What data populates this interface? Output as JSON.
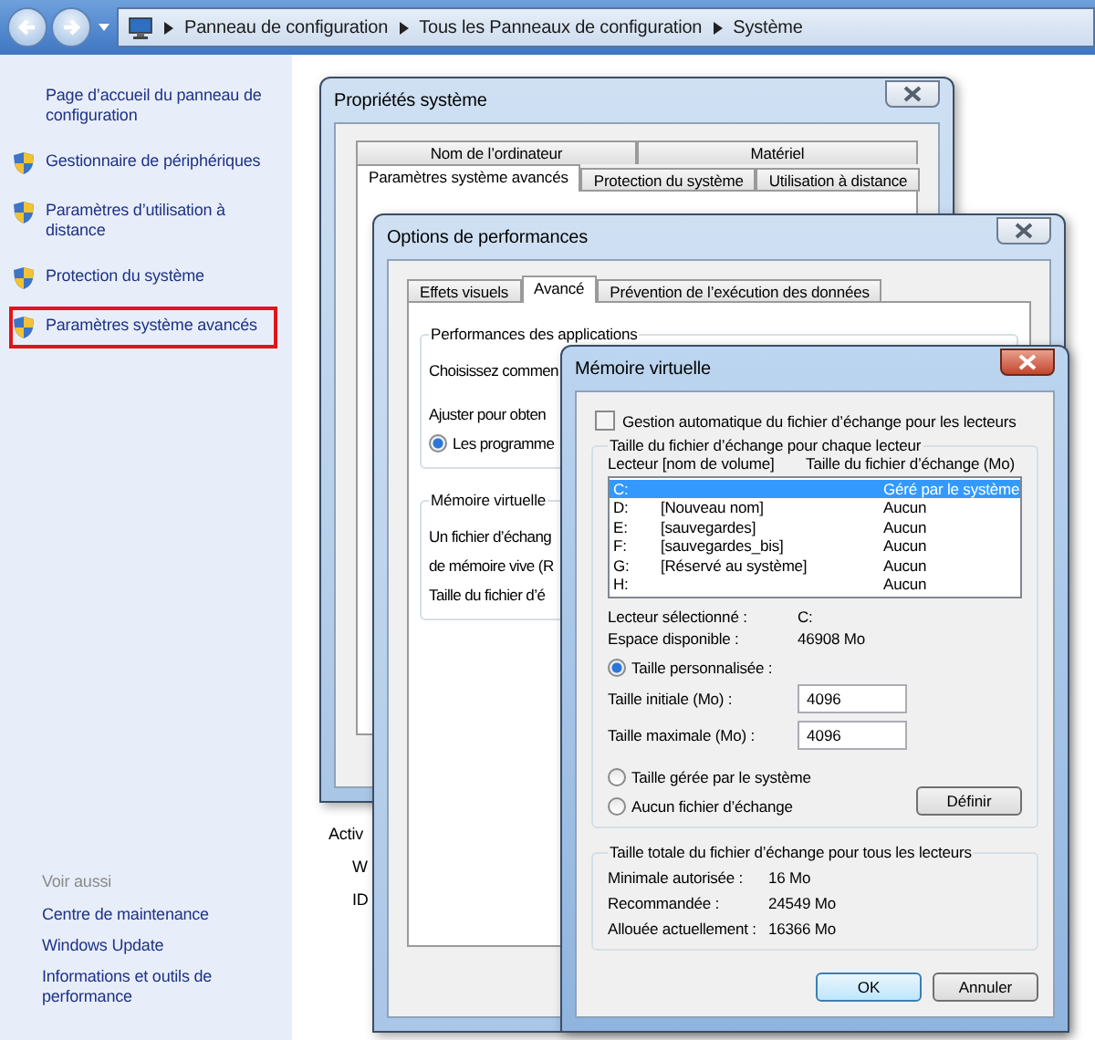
{
  "address_bar": {
    "breadcrumb": [
      "Panneau de configuration",
      "Tous les Panneaux de configuration",
      "Système"
    ]
  },
  "sidebar": {
    "items": [
      {
        "kind": "plain",
        "label": "Page d’accueil du panneau de configuration",
        "highlighted": false
      },
      {
        "kind": "shield",
        "label": "Gestionnaire de périphériques",
        "highlighted": false
      },
      {
        "kind": "shield",
        "label": "Paramètres d’utilisation à distance",
        "highlighted": false
      },
      {
        "kind": "shield",
        "label": "Protection du système",
        "highlighted": false
      },
      {
        "kind": "shield",
        "label": "Paramètres système avancés",
        "highlighted": true
      }
    ],
    "see_also": {
      "title": "Voir aussi",
      "items": [
        "Centre de maintenance",
        "Windows Update",
        "Informations et outils de performance"
      ]
    }
  },
  "page": {
    "heading": "Activ",
    "lines": [
      "W",
      "ID"
    ]
  },
  "system_properties": {
    "title": "Propriétés système",
    "active": false,
    "tab_rows": [
      {
        "tabs": [
          {
            "label": "Nom de l’ordinateur",
            "selected": false
          },
          {
            "label": "Matériel",
            "selected": false
          }
        ]
      },
      {
        "tabs": [
          {
            "label": "Paramètres système avancés",
            "selected": true
          },
          {
            "label": "Protection du système",
            "selected": false
          },
          {
            "label": "Utilisation à distance",
            "selected": false
          }
        ]
      }
    ]
  },
  "performance_options": {
    "title": "Options de performances",
    "active": false,
    "tabs": [
      {
        "label": "Effets visuels",
        "selected": false
      },
      {
        "label": "Avancé",
        "selected": true
      },
      {
        "label": "Prévention de l’exécution des données",
        "selected": false
      }
    ],
    "groups": [
      {
        "title": "Performances des applications",
        "lines": [
          {
            "kind": "text",
            "text": "Choisissez commen"
          },
          {
            "kind": "text",
            "text": "Ajuster pour obten"
          },
          {
            "kind": "radio",
            "text": "Les programme",
            "selected": true
          }
        ]
      },
      {
        "title": "Mémoire virtuelle",
        "lines": [
          {
            "kind": "text",
            "text": "Un fichier d’échang"
          },
          {
            "kind": "text",
            "text": "de mémoire vive (R"
          },
          {
            "kind": "text",
            "text": "Taille du fichier d’é"
          }
        ]
      }
    ]
  },
  "virtual_memory": {
    "title": "Mémoire virtuelle",
    "active": true,
    "automatic": {
      "label": "Gestion automatique du fichier d’échange pour les lecteurs",
      "checked": false
    },
    "drives_group": {
      "title": "Taille du fichier d’échange pour chaque lecteur",
      "columns": [
        "Lecteur [nom de volume]",
        "Taille du fichier d’échange (Mo)"
      ],
      "rows": [
        {
          "drive": "C:",
          "size": "Géré par le système",
          "selected": true
        },
        {
          "drive": "D:",
          "volume": "[Nouveau nom]",
          "size": "Aucun",
          "selected": false
        },
        {
          "drive": "E:",
          "volume": "[sauvegardes]",
          "size": "Aucun",
          "selected": false
        },
        {
          "drive": "F:",
          "volume": "[sauvegardes_bis]",
          "size": "Aucun",
          "selected": false
        },
        {
          "drive": "G:",
          "volume": "[Réservé au système]",
          "size": "Aucun",
          "selected": false
        },
        {
          "drive": "H:",
          "size": "Aucun",
          "selected": false
        }
      ],
      "info": [
        {
          "label": "Lecteur sélectionné :",
          "value": "C:"
        },
        {
          "label": "Espace disponible :",
          "value": "46908 Mo"
        }
      ],
      "size_options": [
        {
          "label": "Taille personnalisée :",
          "selected": true
        },
        {
          "label": "Taille gérée par le système",
          "selected": false
        },
        {
          "label": "Aucun fichier d’échange",
          "selected": false
        }
      ],
      "fields": [
        {
          "label": "Taille initiale (Mo) :",
          "value": "4096"
        },
        {
          "label": "Taille maximale (Mo) :",
          "value": "4096"
        }
      ],
      "set_button": "Définir"
    },
    "totals_group": {
      "title": "Taille totale du fichier d’échange pour tous les lecteurs",
      "rows": [
        {
          "label": "Minimale autorisée :",
          "value": "16 Mo"
        },
        {
          "label": "Recommandée :",
          "value": "24549 Mo"
        },
        {
          "label": "Allouée actuellement :",
          "value": "16366 Mo"
        }
      ]
    },
    "buttons": [
      {
        "label": "OK",
        "default": true
      },
      {
        "label": "Annuler",
        "default": false
      }
    ]
  }
}
